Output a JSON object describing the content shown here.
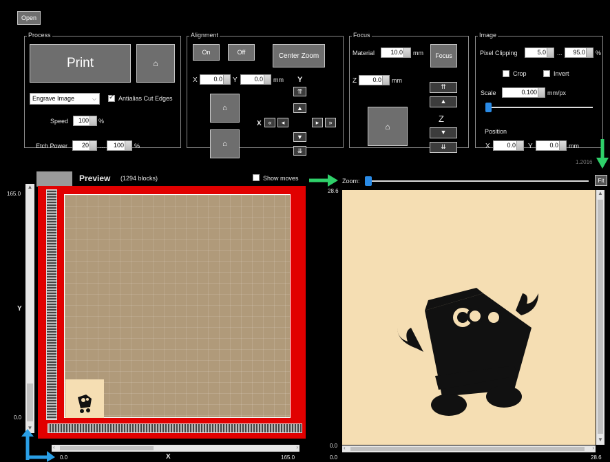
{
  "toolbar": {
    "open_label": "Open"
  },
  "process": {
    "title": "Process",
    "print_label": "Print",
    "mode_select": "Engrave Image",
    "antialias_label": "Antialias Cut Edges",
    "speed_label": "Speed",
    "speed_value": "100",
    "speed_unit": "%",
    "etch_label": "Etch Power",
    "etch_min": "20",
    "etch_max": "100",
    "etch_unit": "%"
  },
  "alignment": {
    "title": "Alignment",
    "on_label": "On",
    "off_label": "Off",
    "center_zoom_label": "Center Zoom",
    "x_label": "X",
    "x_value": "0.0",
    "y_label": "Y",
    "y_value": "0.0",
    "unit": "mm",
    "y_axis_label": "Y",
    "x_axis_label": "X"
  },
  "focus": {
    "title": "Focus",
    "material_label": "Material",
    "material_value": "10.0",
    "material_unit": "mm",
    "focus_label": "Focus",
    "z_label": "Z",
    "z_value": "0.0",
    "z_unit": "mm",
    "z_axis_label": "Z"
  },
  "image": {
    "title": "Image",
    "clip_label": "Pixel Clipping",
    "clip_min": "5.0",
    "clip_max": "95.0",
    "clip_unit": "%",
    "crop_label": "Crop",
    "invert_label": "Invert",
    "scale_label": "Scale",
    "scale_value": "0.100",
    "scale_unit": "mm/px",
    "position_label": "Position",
    "pos_x_label": "X",
    "pos_x_value": "0.0",
    "pos_y_label": "Y",
    "pos_y_value": "0.0",
    "pos_unit": "mm",
    "version": "1.2016"
  },
  "preview": {
    "title": "Preview",
    "blocks": "(1294 blocks)",
    "show_moves_label": "Show moves",
    "y_top": "165.0",
    "y_axis": "Y",
    "y_bottom": "0.0",
    "x_left": "0.0",
    "x_axis": "X",
    "x_right": "165.0"
  },
  "zoom": {
    "label": "Zoom:",
    "fit_label": "Fit",
    "top_value": "28.6",
    "bottom_value": "0.0",
    "x_left": "0.0",
    "x_right": "28.6"
  },
  "colors": {
    "bed_red": "#e10000",
    "canvas_bg": "#f5deb3",
    "annotation_green": "#2fd06a",
    "annotation_blue": "#2a9fe6"
  }
}
